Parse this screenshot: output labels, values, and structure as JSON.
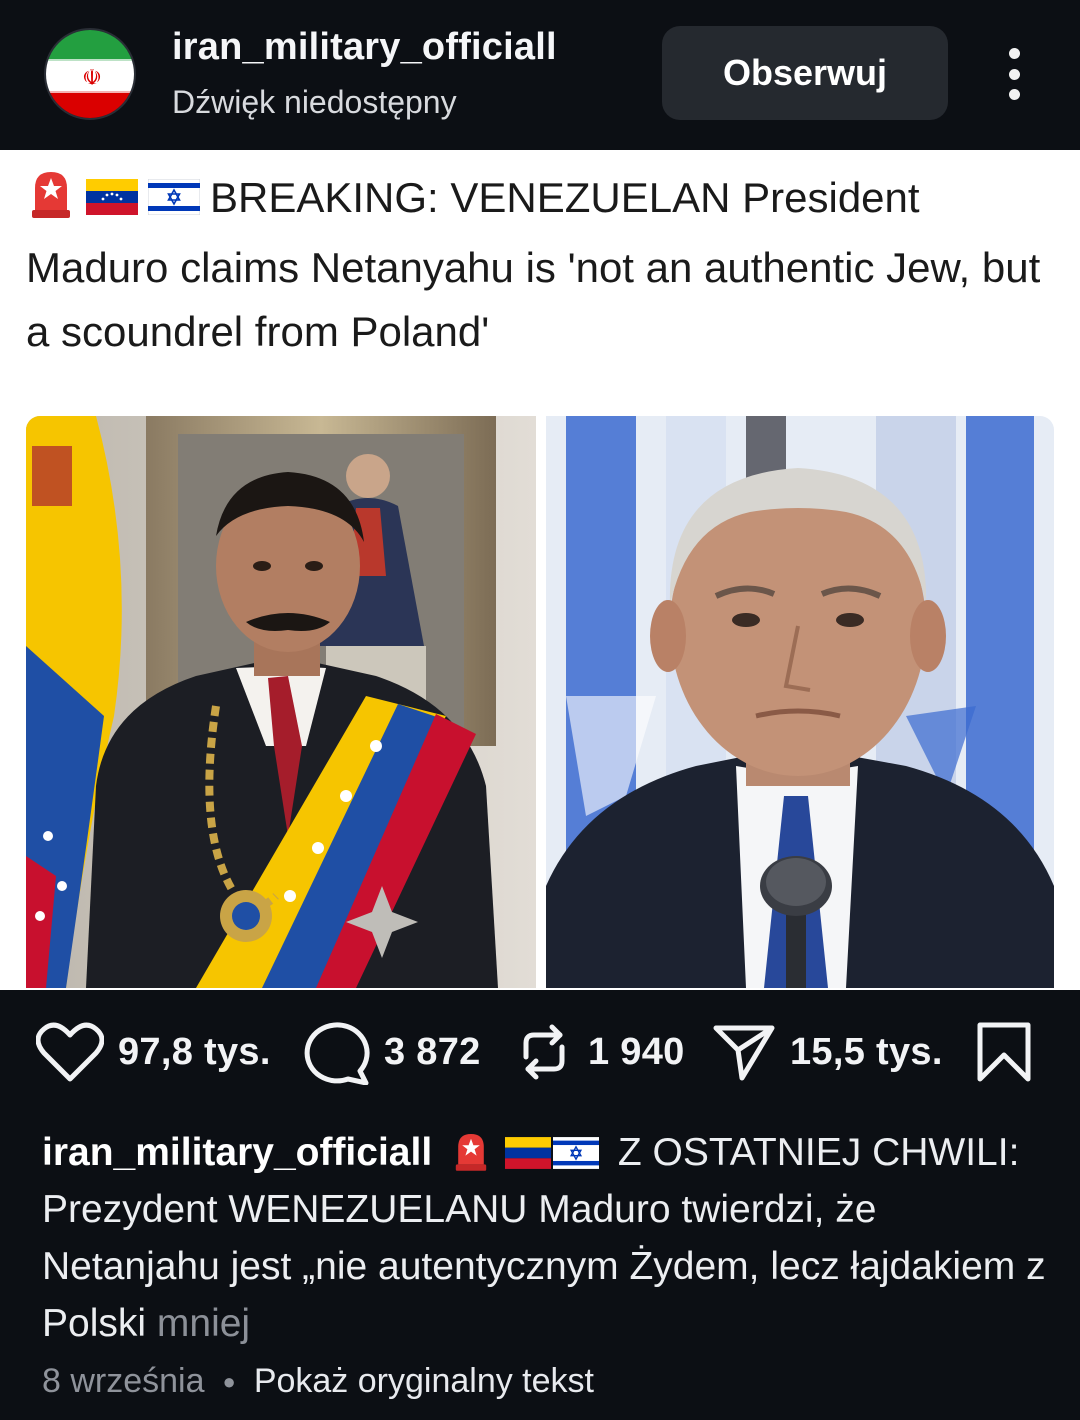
{
  "header": {
    "username": "iran_military_officiall",
    "audio_status": "Dźwięk niedostępny",
    "follow_label": "Obserwuj",
    "avatar_icon": "iran-flag-avatar",
    "more_icon": "vertical-dots-icon"
  },
  "post": {
    "headline_emojis": [
      "rotating-light-icon",
      "venezuela-flag-icon",
      "israel-flag-icon"
    ],
    "headline_text": "BREAKING: VENEZUELAN President Maduro claims Netanyahu is 'not an authentic Jew, but a scoundrel from Poland'",
    "images": [
      {
        "subject": "Maduro portrait with Venezuelan flag and presidential sash"
      },
      {
        "subject": "Netanyahu portrait in front of Israeli flags at microphone"
      }
    ]
  },
  "actions": {
    "likes": "97,8 tys.",
    "comments": "3 872",
    "reposts": "1 940",
    "shares": "15,5 tys."
  },
  "caption": {
    "username": "iran_military_officiall",
    "text": "Z OSTATNIEJ CHWILI: Prezydent WENEZUELANU Maduro twierdzi, że Netanjahu jest „nie autentycznym Żydem, lecz łajdakiem z Polski",
    "less_label": "mniej"
  },
  "meta": {
    "date": "8 września",
    "show_original": "Pokaż oryginalny tekst"
  },
  "colors": {
    "background": "#0c0f14",
    "follow_button": "#25292f",
    "muted_text": "#8f939b"
  }
}
